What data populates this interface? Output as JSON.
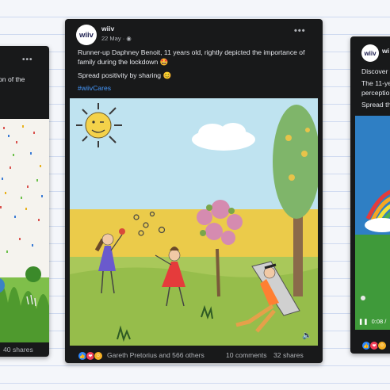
{
  "main_post": {
    "page_name": "wiiv",
    "date": "22 May",
    "date_sep": " · ",
    "more": "•••",
    "body_line1": "Runner-up Daphney Benoit, 11 years old, rightly depicted the importance of family during the lockdown ",
    "emoji_starstruck": "🤩",
    "body_line2": "Spread positivity by sharing ",
    "emoji_smile": "😊",
    "hashtag": "#wiivCares",
    "reactions_text": "Gareth Pretorius and 566 others",
    "comments": "10 comments",
    "shares": "32 shares"
  },
  "left_post": {
    "more": "•••",
    "text_fragment": "on of the",
    "shares": "40 shares"
  },
  "right_post": {
    "page_name": "wiiv",
    "name_fragment": "wi",
    "line1": "Discover",
    "line2": "The 11-ye",
    "line3": "perceptio",
    "line4": "Spread th",
    "video_time": "0:08 /"
  },
  "colors": {
    "card_bg": "#18191a",
    "text_primary": "#e4e6eb",
    "text_secondary": "#b0b3b8",
    "hashtag": "#4599ff",
    "like": "#2d88ff",
    "love": "#f33e58",
    "haha": "#f7b125"
  }
}
